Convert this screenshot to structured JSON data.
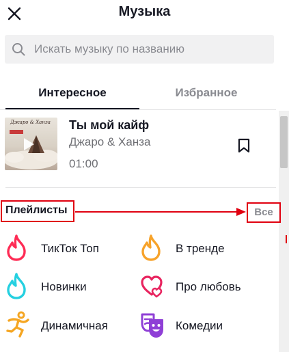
{
  "header": {
    "title": "Музыка"
  },
  "search": {
    "placeholder": "Искать музыку по названию"
  },
  "tabs": [
    {
      "label": "Интересное",
      "active": true
    },
    {
      "label": "Избранное",
      "active": false
    }
  ],
  "song": {
    "title": "Ты мой кайф",
    "artist": "Джаро & Ханза",
    "duration": "01:00",
    "cover_text": "Джаро & Ханза"
  },
  "playlists": {
    "title": "Плейлисты",
    "all_label": "Все",
    "items": [
      {
        "label": "ТикТок Топ",
        "icon": "flame-icon",
        "color": "#fe2c55"
      },
      {
        "label": "В тренде",
        "icon": "flame-icon",
        "color": "#f7a32b"
      },
      {
        "label": "Новинки",
        "icon": "flame-icon",
        "color": "#25d0e0"
      },
      {
        "label": "Про любовь",
        "icon": "hearts-icon",
        "color": "#e8245f"
      },
      {
        "label": "Динамичная",
        "icon": "running-person-icon",
        "color": "#f5a623"
      },
      {
        "label": "Комедии",
        "icon": "theater-masks-icon",
        "color": "#8f3fd6"
      }
    ]
  },
  "colors": {
    "accent_annotation": "#e0000f",
    "text_primary": "#161823",
    "text_secondary": "#8a8b91"
  }
}
